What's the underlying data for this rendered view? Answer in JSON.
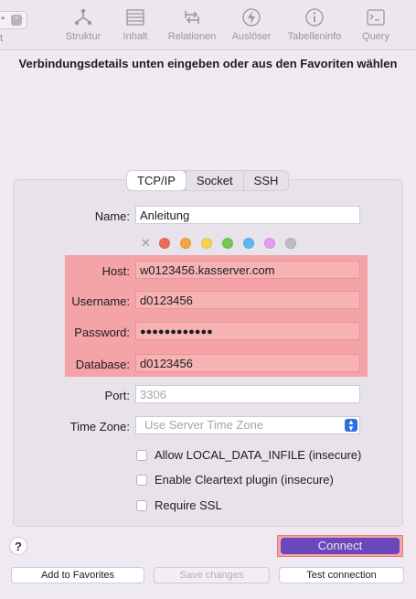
{
  "toolbar": {
    "left_fragment": "t",
    "items": [
      {
        "label": "Struktur",
        "icon": "structure-icon"
      },
      {
        "label": "Inhalt",
        "icon": "content-icon"
      },
      {
        "label": "Relationen",
        "icon": "relations-icon"
      },
      {
        "label": "Auslöser",
        "icon": "triggers-icon"
      },
      {
        "label": "Tabelleninfo",
        "icon": "table-info-icon"
      },
      {
        "label": "Query",
        "icon": "query-icon"
      }
    ]
  },
  "prompt": "Verbindungsdetails unten eingeben oder aus den Favoriten wählen",
  "tabs": [
    "TCP/IP",
    "Socket",
    "SSH"
  ],
  "form": {
    "name_label": "Name:",
    "name_value": "Anleitung",
    "clear_color": "✕",
    "colors": [
      "#ee6a5f",
      "#f5a443",
      "#f5d44b",
      "#74c75a",
      "#5ab8f5",
      "#e59cf0",
      "#bdbdbd"
    ],
    "host_label": "Host:",
    "host_value": "w0123456.kasserver.com",
    "username_label": "Username:",
    "username_value": "d0123456",
    "password_label": "Password:",
    "password_value": "●●●●●●●●●●●●",
    "database_label": "Database:",
    "database_value": "d0123456",
    "port_label": "Port:",
    "port_placeholder": "3306",
    "timezone_label": "Time Zone:",
    "timezone_value": "Use Server Time Zone",
    "checkbox_local_data": "Allow LOCAL_DATA_INFILE (insecure)",
    "checkbox_cleartext": "Enable Cleartext plugin (insecure)",
    "checkbox_ssl": "Require SSL"
  },
  "buttons": {
    "help": "?",
    "connect": "Connect",
    "add_favorites": "Add to Favorites",
    "save_changes": "Save changes",
    "test_connection": "Test connection"
  },
  "colors": {
    "highlight": "#f4a3a6",
    "connect": "#6a48b9",
    "accent": "#2b6ee8"
  }
}
